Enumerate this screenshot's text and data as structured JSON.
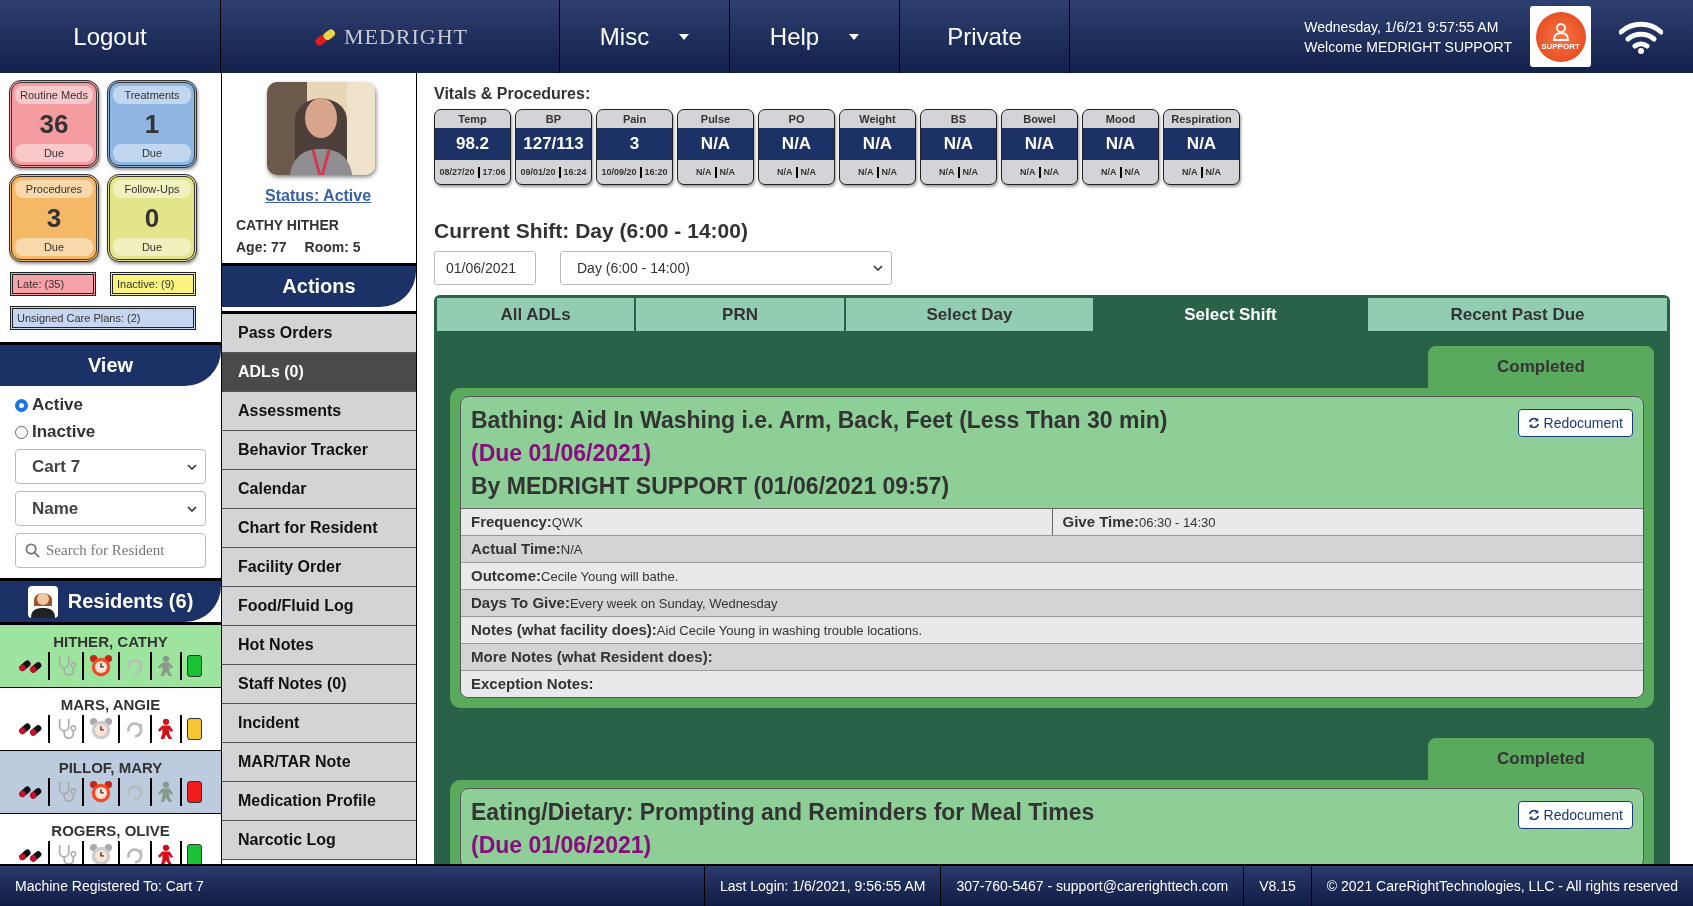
{
  "nav": {
    "logout": "Logout",
    "logo": "MEDRIGHT",
    "menus": [
      {
        "label": "Misc",
        "dropdown": true
      },
      {
        "label": "Help",
        "dropdown": true
      },
      {
        "label": "Private",
        "dropdown": false
      }
    ],
    "datetime": "Wednesday, 1/6/21 9:57:55 AM",
    "welcome": "Welcome MEDRIGHT SUPPORT",
    "support": "SUPPORT"
  },
  "due_tiles": [
    {
      "title": "Routine Meds",
      "count": "36",
      "label": "Due",
      "color": "#f49ca0"
    },
    {
      "title": "Treatments",
      "count": "1",
      "label": "Due",
      "color": "#8fb6e3"
    },
    {
      "title": "Procedures",
      "count": "3",
      "label": "Due",
      "color": "#f5b867"
    },
    {
      "title": "Follow-Ups",
      "count": "0",
      "label": "Due",
      "color": "#e3e58a"
    }
  ],
  "badges": [
    {
      "text": "Late: (35)",
      "color": "#f5a3a8"
    },
    {
      "text": "Inactive: (9)",
      "color": "#faf37e"
    },
    {
      "text": "Unsigned Care Plans: (2)",
      "color": "#c7d6f0"
    }
  ],
  "view": {
    "title": "View",
    "radios": [
      {
        "label": "Active",
        "selected": true
      },
      {
        "label": "Inactive",
        "selected": false
      }
    ],
    "cart": "Cart 7",
    "sort": "Name",
    "search_placeholder": "Search for Resident"
  },
  "residents_title": "Residents (6)",
  "residents": [
    {
      "name": "HITHER, CATHY",
      "selected": true,
      "highlighted": false,
      "alarm": true,
      "person_alert": false,
      "color": "#19c234"
    },
    {
      "name": "MARS, ANGIE",
      "selected": false,
      "highlighted": false,
      "alarm": false,
      "person_alert": true,
      "color": "#f7c531"
    },
    {
      "name": "PILLOF, MARY",
      "selected": false,
      "highlighted": true,
      "alarm": true,
      "person_alert": false,
      "color": "#f01c1c"
    },
    {
      "name": "ROGERS, OLIVE",
      "selected": false,
      "highlighted": false,
      "alarm": false,
      "person_alert": true,
      "color": "#19c234"
    }
  ],
  "profile": {
    "status": "Status: Active",
    "name": "CATHY HITHER",
    "age": "Age: 77",
    "room": "Room: 5"
  },
  "actions": {
    "title": "Actions",
    "items": [
      {
        "label": "Pass Orders",
        "selected": false
      },
      {
        "label": "ADLs (0)",
        "selected": true
      },
      {
        "label": "Assessments",
        "selected": false
      },
      {
        "label": "Behavior Tracker",
        "selected": false
      },
      {
        "label": "Calendar",
        "selected": false
      },
      {
        "label": "Chart for Resident",
        "selected": false
      },
      {
        "label": "Facility Order",
        "selected": false
      },
      {
        "label": "Food/Fluid Log",
        "selected": false
      },
      {
        "label": "Hot Notes",
        "selected": false
      },
      {
        "label": "Staff Notes (0)",
        "selected": false
      },
      {
        "label": "Incident",
        "selected": false
      },
      {
        "label": "MAR/TAR Note",
        "selected": false
      },
      {
        "label": "Medication Profile",
        "selected": false
      },
      {
        "label": "Narcotic Log",
        "selected": false
      }
    ]
  },
  "vitals": {
    "title": "Vitals & Procedures:",
    "items": [
      {
        "label": "Temp",
        "value": "98.2",
        "date": "08/27/20",
        "time": "17:06"
      },
      {
        "label": "BP",
        "value": "127/113",
        "date": "09/01/20",
        "time": "16:24"
      },
      {
        "label": "Pain",
        "value": "3",
        "date": "10/09/20",
        "time": "16:20"
      },
      {
        "label": "Pulse",
        "value": "N/A",
        "date": "N/A",
        "time": "N/A"
      },
      {
        "label": "PO",
        "value": "N/A",
        "date": "N/A",
        "time": "N/A"
      },
      {
        "label": "Weight",
        "value": "N/A",
        "date": "N/A",
        "time": "N/A"
      },
      {
        "label": "BS",
        "value": "N/A",
        "date": "N/A",
        "time": "N/A"
      },
      {
        "label": "Bowel",
        "value": "N/A",
        "date": "N/A",
        "time": "N/A"
      },
      {
        "label": "Mood",
        "value": "N/A",
        "date": "N/A",
        "time": "N/A"
      },
      {
        "label": "Respiration",
        "value": "N/A",
        "date": "N/A",
        "time": "N/A"
      }
    ]
  },
  "shift": {
    "title": "Current Shift: Day (6:00 - 14:00)",
    "date": "01/06/2021",
    "select": "Day (6:00 - 14:00)"
  },
  "tabs": [
    {
      "label": "All ADLs",
      "selected": false
    },
    {
      "label": "PRN",
      "selected": false
    },
    {
      "label": "Select Day",
      "selected": false
    },
    {
      "label": "Select Shift",
      "selected": true
    },
    {
      "label": "Recent Past Due",
      "selected": false
    }
  ],
  "adls": [
    {
      "status": "Completed",
      "title": "Bathing: Aid In Washing i.e. Arm, Back, Feet (Less Than 30 min)",
      "due": "(Due 01/06/2021)",
      "by": "By MEDRIGHT SUPPORT (01/06/2021 09:57)",
      "button": "Redocument",
      "rows": [
        [
          {
            "label": "Frequency:",
            "value": "QWK"
          },
          {
            "label": "Give Time:",
            "value": "06:30 - 14:30"
          }
        ],
        [
          {
            "label": "Actual Time:",
            "value": "N/A"
          }
        ],
        [
          {
            "label": "Outcome:",
            "value": "Cecile Young will bathe."
          }
        ],
        [
          {
            "label": "Days To Give:",
            "value": "Every week on Sunday, Wednesday"
          }
        ],
        [
          {
            "label": "Notes (what facility does):",
            "value": "Aid Cecile Young in washing trouble locations."
          }
        ],
        [
          {
            "label": "More Notes (what Resident does):"
          }
        ],
        [
          {
            "label": "Exception Notes:"
          }
        ]
      ]
    },
    {
      "status": "Completed",
      "title": "Eating/Dietary: Prompting and Reminders for Meal Times",
      "due": "(Due 01/06/2021)",
      "button": "Redocument"
    }
  ],
  "footer": {
    "machine": "Machine Registered To: Cart 7",
    "last_login": "Last Login: 1/6/2021, 9:56:55 AM",
    "contact": "307-760-5467 - support@carerighttech.com",
    "version": "V8.15",
    "copyright": "© 2021 CareRightTechnologies, LLC - All rights reserved"
  }
}
